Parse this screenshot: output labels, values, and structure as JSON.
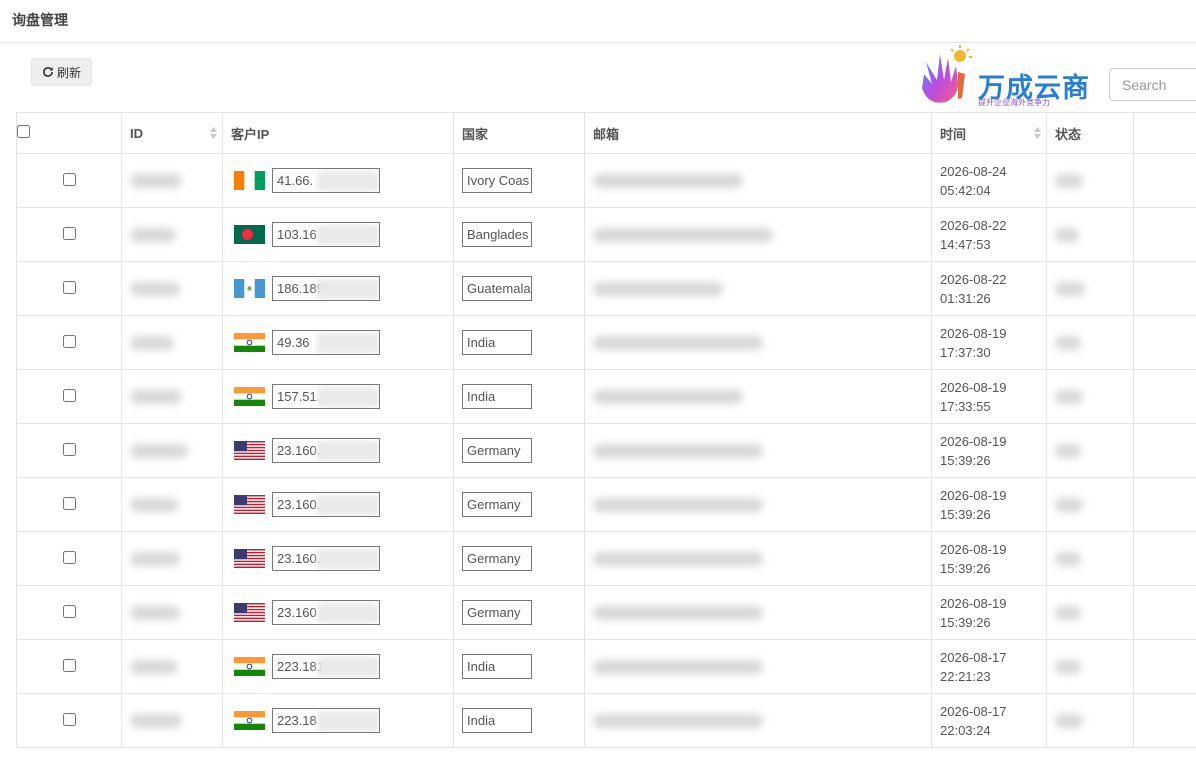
{
  "page": {
    "title": "询盘管理"
  },
  "toolbar": {
    "refresh_label": "刷新"
  },
  "logo": {
    "name": "万成云商",
    "slogan": "提升企业海外竞争力"
  },
  "search": {
    "placeholder": "Search"
  },
  "columns": {
    "id": "ID",
    "ip": "客户IP",
    "country": "国家",
    "email": "邮箱",
    "time": "时间",
    "status": "状态"
  },
  "rows": [
    {
      "flag": "ci",
      "ip": "41.66.",
      "country": "Ivory Coas",
      "date": "2026-08-24",
      "clock": "05:42:04"
    },
    {
      "flag": "bd",
      "ip": "103.16",
      "country": "Banglades",
      "date": "2026-08-22",
      "clock": "14:47:53"
    },
    {
      "flag": "gt",
      "ip": "186.189",
      "country": "Guatemala",
      "date": "2026-08-22",
      "clock": "01:31:26"
    },
    {
      "flag": "in",
      "ip": "49.36",
      "country": "India",
      "date": "2026-08-19",
      "clock": "17:37:30"
    },
    {
      "flag": "in",
      "ip": "157.51.",
      "country": "India",
      "date": "2026-08-19",
      "clock": "17:33:55"
    },
    {
      "flag": "us",
      "ip": "23.160.",
      "country": "Germany",
      "date": "2026-08-19",
      "clock": "15:39:26"
    },
    {
      "flag": "us",
      "ip": "23.160.",
      "country": "Germany",
      "date": "2026-08-19",
      "clock": "15:39:26"
    },
    {
      "flag": "us",
      "ip": "23.160.",
      "country": "Germany",
      "date": "2026-08-19",
      "clock": "15:39:26"
    },
    {
      "flag": "us",
      "ip": "23.160",
      "country": "Germany",
      "date": "2026-08-19",
      "clock": "15:39:26"
    },
    {
      "flag": "in",
      "ip": "223.181",
      "country": "India",
      "date": "2026-08-17",
      "clock": "22:21:23"
    },
    {
      "flag": "in",
      "ip": "223.18",
      "country": "India",
      "date": "2026-08-17",
      "clock": "22:03:24"
    }
  ],
  "colors": {
    "header_border": "#e7e7e7",
    "button_bg": "#eeeeee",
    "logo_blue": "#2a7fd4",
    "logo_purple": "#8a4ad8"
  }
}
